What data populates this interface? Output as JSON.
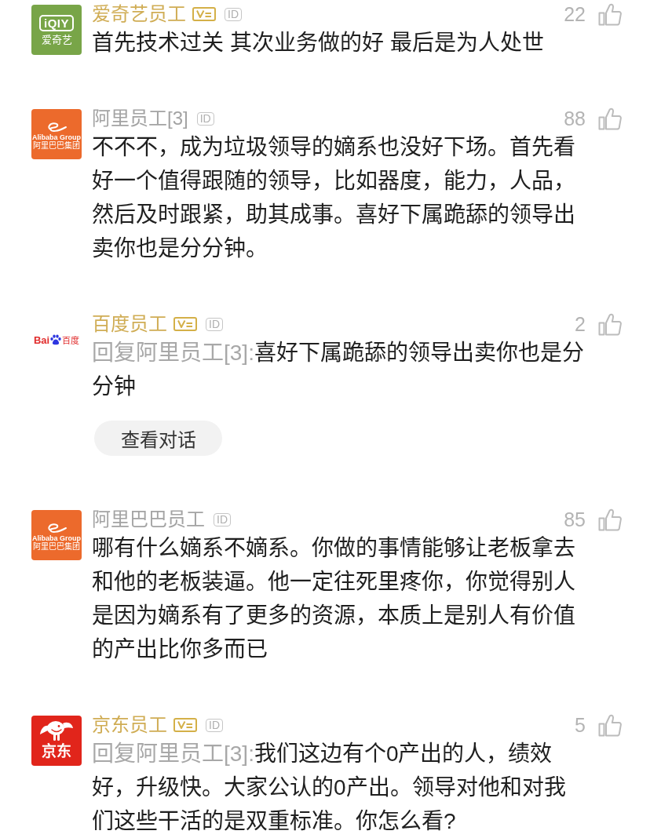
{
  "comments": [
    {
      "author": "爱奇艺员工",
      "verified": true,
      "tag": "ID",
      "likes": "22",
      "avatar": {
        "kind": "iqiyi",
        "texts": [
          "iQIY",
          "爱奇艺"
        ]
      },
      "text": "首先技术过关 其次业务做的好 最后是为人处世"
    },
    {
      "author": "阿里员工[3]",
      "verified": false,
      "tag": "ID",
      "likes": "88",
      "avatar": {
        "kind": "alibaba",
        "texts": [
          "Alibaba Group",
          "阿里巴巴集团"
        ]
      },
      "text": "不不不，成为垃圾领导的嫡系也没好下场。首先看好一个值得跟随的领导，比如器度，能力，人品，然后及时跟紧，助其成事。喜好下属跪舔的领导出卖你也是分分钟。"
    },
    {
      "author": "百度员工",
      "verified": true,
      "tag": "ID",
      "likes": "2",
      "avatar": {
        "kind": "baidu",
        "texts": [
          "Bai",
          "百度"
        ]
      },
      "reply_prefix": "回复阿里员工[3]:",
      "text": "喜好下属跪舔的领导出卖你也是分分钟",
      "action": "查看对话"
    },
    {
      "author": "阿里巴巴员工",
      "verified": false,
      "tag": "ID",
      "likes": "85",
      "avatar": {
        "kind": "alibaba",
        "texts": [
          "Alibaba Group",
          "阿里巴巴集团"
        ]
      },
      "text": "哪有什么嫡系不嫡系。你做的事情能够让老板拿去和他的老板装逼。他一定往死里疼你，你觉得别人是因为嫡系有了更多的资源，本质上是别人有价值的产出比你多而已"
    },
    {
      "author": "京东员工",
      "verified": true,
      "tag": "ID",
      "likes": "5",
      "avatar": {
        "kind": "jd",
        "texts": [
          "京东"
        ]
      },
      "reply_prefix": "回复阿里员工[3]:",
      "text": "我们这边有个0产出的人，绩效好，升级快。大家公认的0产出。领导对他和对我们这些干活的是双重标准。你怎么看?"
    }
  ]
}
